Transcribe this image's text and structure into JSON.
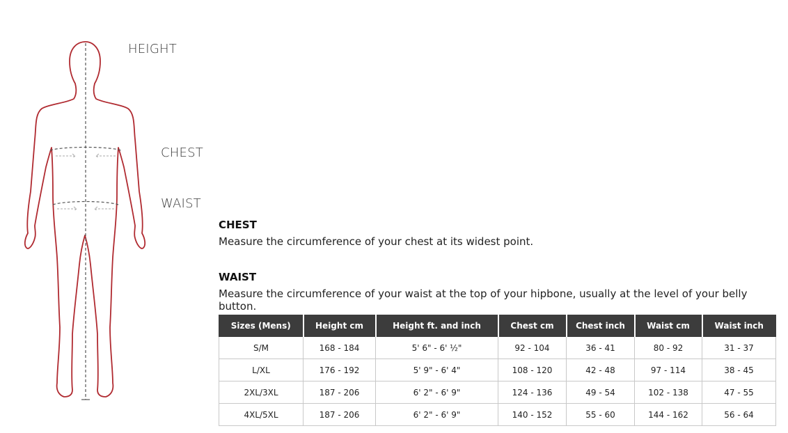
{
  "measure_labels": {
    "height": "HEIGHT",
    "chest": "CHEST",
    "waist": "WAIST"
  },
  "sections": [
    {
      "title": "CHEST",
      "text": "Measure the circumference of your chest at its widest point."
    },
    {
      "title": "WAIST",
      "text": "Measure the circumference of your waist at the top of your hipbone, usually at the level of your belly button."
    }
  ],
  "table": {
    "headers": [
      "Sizes (Mens)",
      "Height cm",
      "Height ft. and inch",
      "Chest cm",
      "Chest inch",
      "Waist cm",
      "Waist inch"
    ],
    "rows": [
      [
        "S/M",
        "168 - 184",
        "5' 6\" - 6' ½\"",
        "92 - 104",
        "36 - 41",
        "80 - 92",
        "31 - 37"
      ],
      [
        "L/XL",
        "176 - 192",
        "5' 9\" - 6' 4\"",
        "108 - 120",
        "42 - 48",
        "97 - 114",
        "38 - 45"
      ],
      [
        "2XL/3XL",
        "187 - 206",
        "6' 2\" - 6' 9\"",
        "124 - 136",
        "49 - 54",
        "102 - 138",
        "47 - 55"
      ],
      [
        "4XL/5XL",
        "187 - 206",
        "6' 2\" - 6' 9\"",
        "140 - 152",
        "55 - 60",
        "144 - 162",
        "56 - 64"
      ]
    ]
  },
  "colors": {
    "outline": "#b02a30",
    "header_bg": "#3c3c3c",
    "guide": "#555555"
  }
}
